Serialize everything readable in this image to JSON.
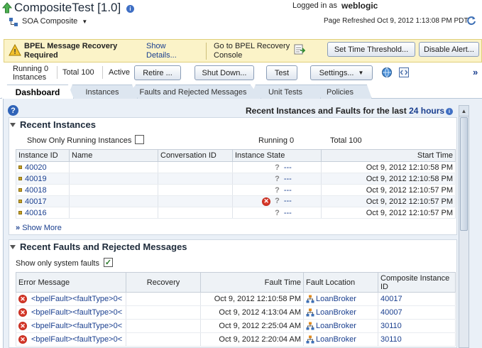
{
  "header": {
    "title": "CompositeTest [1.0]",
    "composite_type": "SOA Composite",
    "logged_in_label": "Logged in as",
    "user": "weblogic",
    "page_refreshed": "Page Refreshed Oct 9, 2012 1:13:08 PM PDT"
  },
  "banner": {
    "title": "BPEL Message Recovery Required",
    "show_details": "Show Details...",
    "goto_console": "Go to BPEL Recovery Console",
    "set_threshold": "Set Time Threshold...",
    "disable_alert": "Disable Alert..."
  },
  "toolbar": {
    "running_label": "Running",
    "running_count": "0",
    "instances_label": "Instances",
    "total_label": "Total",
    "total_count": "100",
    "active_label": "Active",
    "retire": "Retire ...",
    "shutdown": "Shut Down...",
    "test": "Test",
    "settings": "Settings..."
  },
  "tabs": [
    "Dashboard",
    "Instances",
    "Faults and Rejected Messages",
    "Unit Tests",
    "Policies"
  ],
  "recent_summary": {
    "label": "Recent Instances and Faults for the last",
    "period": "24 hours"
  },
  "recent_instances": {
    "title": "Recent Instances",
    "show_running_label": "Show Only Running Instances",
    "running_text": "Running 0",
    "total_text": "Total 100",
    "columns": [
      "Instance ID",
      "Name",
      "Conversation ID",
      "Instance State",
      "Start Time"
    ],
    "rows": [
      {
        "id": "40020",
        "state": "---",
        "faulted": false,
        "start": "Oct 9, 2012 12:10:58 PM"
      },
      {
        "id": "40019",
        "state": "---",
        "faulted": false,
        "start": "Oct 9, 2012 12:10:58 PM"
      },
      {
        "id": "40018",
        "state": "---",
        "faulted": false,
        "start": "Oct 9, 2012 12:10:57 PM"
      },
      {
        "id": "40017",
        "state": "---",
        "faulted": true,
        "start": "Oct 9, 2012 12:10:57 PM"
      },
      {
        "id": "40016",
        "state": "---",
        "faulted": false,
        "start": "Oct 9, 2012 12:10:57 PM"
      }
    ],
    "show_more": "Show More"
  },
  "recent_faults": {
    "title": "Recent Faults and Rejected Messages",
    "show_system_label": "Show only system faults",
    "columns": [
      "Error Message",
      "Recovery",
      "Fault Time",
      "Fault Location",
      "Composite Instance ID"
    ],
    "rows": [
      {
        "msg": "<bpelFault><faultType>0<",
        "time": "Oct 9, 2012 12:10:58 PM",
        "loc": "LoanBroker",
        "cid": "40017"
      },
      {
        "msg": "<bpelFault><faultType>0<",
        "time": "Oct 9, 2012 4:13:04 AM",
        "loc": "LoanBroker",
        "cid": "40007"
      },
      {
        "msg": "<bpelFault><faultType>0<",
        "time": "Oct 9, 2012 2:25:04 AM",
        "loc": "LoanBroker",
        "cid": "30110"
      },
      {
        "msg": "<bpelFault><faultType>0<",
        "time": "Oct 9, 2012 2:20:04 AM",
        "loc": "LoanBroker",
        "cid": "30110"
      }
    ]
  }
}
